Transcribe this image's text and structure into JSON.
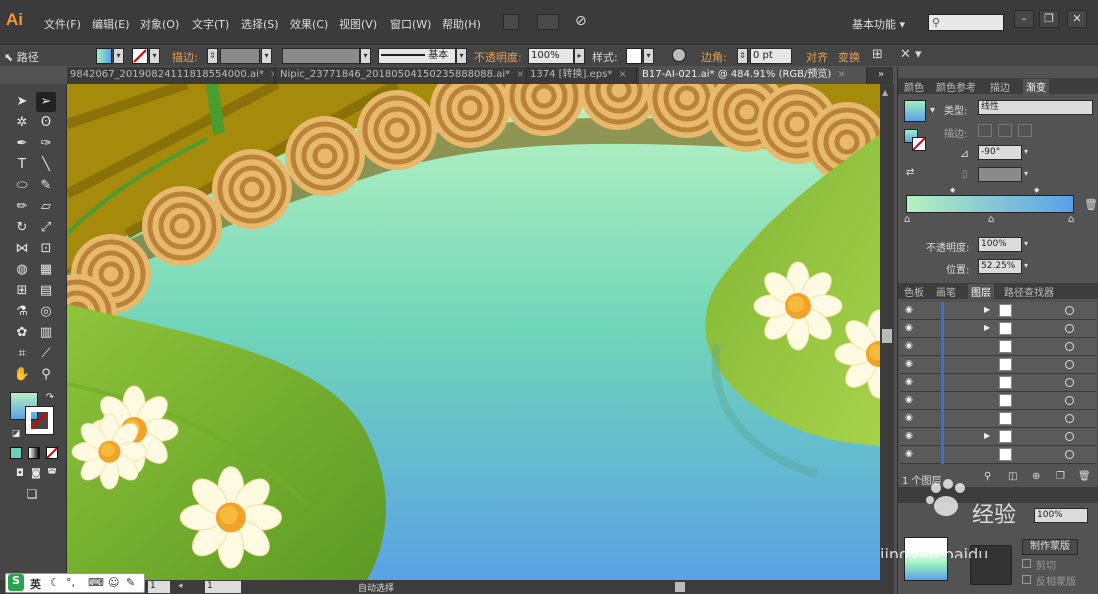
{
  "app": {
    "logo": "Ai",
    "workspace": "基本功能"
  },
  "menus": [
    "文件(F)",
    "编辑(E)",
    "对象(O)",
    "文字(T)",
    "选择(S)",
    "效果(C)",
    "视图(V)",
    "窗口(W)",
    "帮助(H)"
  ],
  "control": {
    "selection_label": "路径",
    "stroke_label": "描边",
    "stroke_style": "基本",
    "opacity_label": "不透明度",
    "opacity_value": "100%",
    "style_label": "样式",
    "corner_label": "边角",
    "corner_value": "0 pt",
    "align_label": "对齐",
    "transform_label": "变换"
  },
  "doc_tabs": [
    {
      "label": "9842067_20190824111818554000.ai*",
      "close": "×"
    },
    {
      "label": "Nipic_23771846_20180504150235888088.ai*",
      "close": "×"
    },
    {
      "label": "1374 [转换].eps*",
      "close": "×"
    },
    {
      "label": "B17-AI-021.ai* @ 484.91% (RGB/预览)",
      "close": "×"
    }
  ],
  "colors": {
    "bg": "#535353",
    "accent": "#3a6fd8",
    "gradient_start": "#b4f1bf",
    "gradient_end": "#5aa0e8"
  },
  "panel_top": {
    "tabs": [
      "颜色",
      "颜色参考",
      "描边",
      "渐变"
    ],
    "type_label": "类型",
    "type_value": "线性",
    "stroke_label": "描边",
    "angle_value": "-90°",
    "opacity_label": "不透明度",
    "opacity_value": "100%",
    "position_label": "位置",
    "position_value": "52.25%"
  },
  "panel_layers": {
    "tabs": [
      "色板",
      "画笔",
      "图层",
      "路径查找器"
    ],
    "footer": "1 个图层",
    "row_count": 9
  },
  "panel_bottom": {
    "opacity_value": "100%",
    "mask_button": "制作蒙版",
    "clip_label": "剪切",
    "invert_label": "反相蒙版"
  },
  "status": {
    "zoom_value": "1",
    "page_value": "1",
    "mode": "自动选择"
  },
  "taskbar": {
    "logo": "S",
    "ime": "英"
  },
  "watermark": {
    "text": "经验",
    "sub": "jingyan.baidu"
  }
}
